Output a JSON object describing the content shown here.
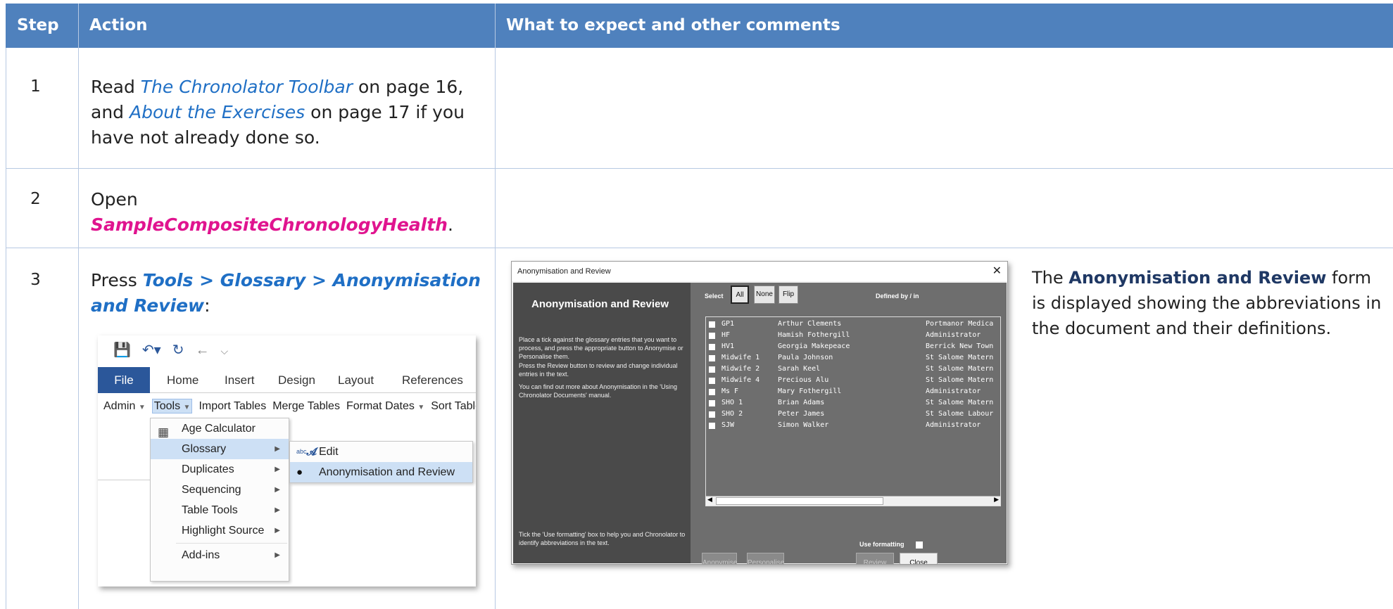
{
  "header": {
    "col1": "Step",
    "col2": "Action",
    "col3": "What to expect and other comments"
  },
  "rows": [
    {
      "step": "1",
      "a1": "Read ",
      "a2": "The Chronolator Toolbar",
      "a3": " on page 16, and ",
      "a4": "About the Exercises",
      "a5": " on page 17 if you have not already done so."
    },
    {
      "step": "2",
      "a1": "Open ",
      "a2": "SampleCompositeChronologyHealth",
      "a3": "."
    },
    {
      "step": "3",
      "a1": "Press ",
      "a2": "Tools > Glossary > Anonymisation and Review",
      "a3": ":",
      "c1": "The ",
      "c2": "Anonymisation and Review",
      "c3": " form is displayed showing the abbreviations in the document and their definitions."
    }
  ],
  "ribbon": {
    "tabs": [
      "File",
      "Home",
      "Insert",
      "Design",
      "Layout",
      "References"
    ],
    "commands": [
      "Admin",
      "Tools",
      "Import Tables",
      "Merge Tables",
      "Format Dates",
      "Sort Tables"
    ],
    "tools_menu": [
      "Age Calculator",
      "Glossary",
      "Duplicates",
      "Sequencing",
      "Table Tools",
      "Highlight Source",
      "Add-ins"
    ],
    "glossary_menu": [
      "Edit",
      "Anonymisation and Review"
    ],
    "edit_icon_text": "abc"
  },
  "dialog": {
    "window_title": "Anonymisation and Review",
    "heading": "Anonymisation and Review",
    "text1": "Place a tick against the glossary entries that you want to process, and press the appropriate button to Anonymise or Personalise them.",
    "text2": "Press the Review button to review and change individual entries in the text.",
    "text3": "You can find out more about Anonymisation in the 'Using Chronolator Documents' manual.",
    "text4": "Tick the 'Use formatting' box to help you and Chronolator to identify abbreviations in the text.",
    "select_label": "Select",
    "btn_all": "All",
    "btn_none": "None",
    "btn_flip": "Flip",
    "defined_by_label": "Defined by / in",
    "entries": [
      {
        "abbr": "GP1",
        "name": "Arthur Clements",
        "def": "Portmanor Medica"
      },
      {
        "abbr": "HF",
        "name": "Hamish Fothergill",
        "def": "Administrator"
      },
      {
        "abbr": "HV1",
        "name": "Georgia Makepeace",
        "def": "Berrick New Town"
      },
      {
        "abbr": "Midwife 1",
        "name": "Paula Johnson",
        "def": "St Salome Matern"
      },
      {
        "abbr": "Midwife 2",
        "name": "Sarah Keel",
        "def": "St Salome Matern"
      },
      {
        "abbr": "Midwife 4",
        "name": "Precious Alu",
        "def": "St Salome Matern"
      },
      {
        "abbr": "Ms F",
        "name": "Mary Fothergill",
        "def": "Administrator"
      },
      {
        "abbr": "SHO 1",
        "name": "Brian Adams",
        "def": "St Salome Matern"
      },
      {
        "abbr": "SHO 2",
        "name": "Peter James",
        "def": "St Salome Labour"
      },
      {
        "abbr": "SJW",
        "name": "Simon Walker",
        "def": "Administrator"
      }
    ],
    "use_formatting_label": "Use formatting",
    "btn_anonymise": "Anonymise",
    "btn_personalise": "Personalise",
    "btn_review": "Review",
    "btn_close": "Close"
  }
}
